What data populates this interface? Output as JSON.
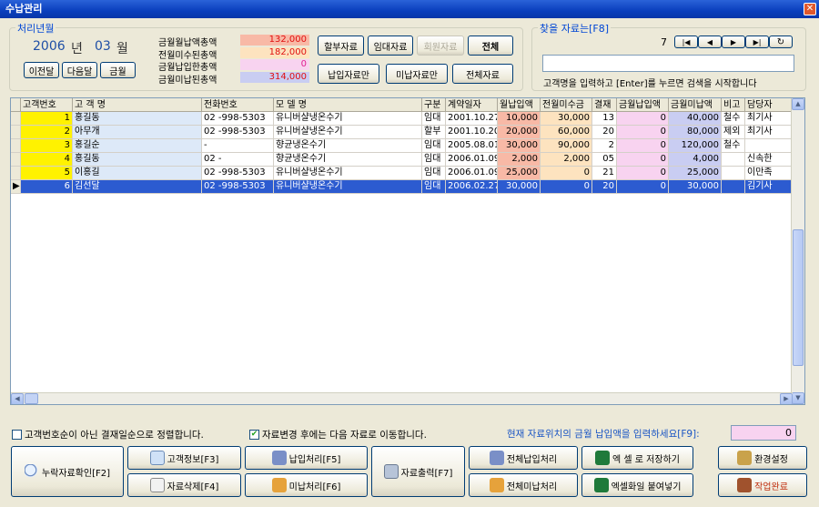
{
  "window": {
    "title": "수납관리"
  },
  "period": {
    "legend": "처리년월",
    "year": "2006",
    "year_unit": "년",
    "month": "03",
    "month_unit": "월",
    "prev_label": "이전달",
    "next_label": "다음달",
    "current_label": "금월"
  },
  "summary": [
    {
      "label": "금월월납액총액",
      "value": "132,000",
      "color": "#f8b9a6"
    },
    {
      "label": "전월미수된총액",
      "value": "182,000",
      "color": "#fde3bf"
    },
    {
      "label": "금월납입한총액",
      "value": "0",
      "color": "#f8d3f0"
    },
    {
      "label": "금월미납된총액",
      "value": "314,000",
      "color": "#c9cdf2"
    }
  ],
  "filters": {
    "installment": "할부자료",
    "rental": "임대자료",
    "member": "회원자료",
    "all": "전체",
    "paid_only": "납입자료만",
    "unpaid_only": "미납자료만",
    "all_data": "전체자료"
  },
  "search": {
    "legend": "찾을 자료는[F8]",
    "record_no": "7",
    "placeholder": "",
    "hint": "고객명을 입력하고 [Enter]를 누르면 검색을 시작합니다"
  },
  "table": {
    "headers": [
      "고객번호",
      "고 객 명",
      "전화번호",
      "모   델   명",
      "구분",
      "계약일자",
      "월납입액",
      "전월미수금",
      "결재",
      "금월납입액",
      "금월미납액",
      "비고",
      "담당자"
    ],
    "rows": [
      [
        "1",
        "홍길동",
        "02  -998-5303",
        "유니버샬냉온수기",
        "임대",
        "2001.10.27",
        "10,000",
        "30,000",
        "13",
        "0",
        "40,000",
        "철수",
        "최기사"
      ],
      [
        "2",
        "아무개",
        "02  -998-5303",
        "유니버샬냉온수기",
        "할부",
        "2001.10.20",
        "20,000",
        "60,000",
        "20",
        "0",
        "80,000",
        "제외",
        "최기사"
      ],
      [
        "3",
        "홍길순",
        "      -",
        "향균냉온수기",
        "임대",
        "2005.08.01",
        "30,000",
        "90,000",
        "2",
        "0",
        "120,000",
        "철수",
        ""
      ],
      [
        "4",
        "홍길동",
        "02  -",
        "향균냉온수기",
        "임대",
        "2006.01.09",
        "2,000",
        "2,000",
        "05",
        "0",
        "4,000",
        "",
        "신속한"
      ],
      [
        "5",
        "이홍길",
        "02  -998-5303",
        "유니버샬냉온수기",
        "임대",
        "2006.01.09",
        "25,000",
        "0",
        "21",
        "0",
        "25,000",
        "",
        "이만족"
      ],
      [
        "6",
        "김선달",
        "02  -998-5303",
        "유니버샬냉온수기",
        "임대",
        "2006.02.27",
        "30,000",
        "0",
        "20",
        "0",
        "30,000",
        "",
        "김기사"
      ]
    ],
    "selected_row": 5
  },
  "options": {
    "sort_label": "고객번호순이 아닌 결재일순으로 정렬합니다.",
    "sort_checked": false,
    "move_label": "자료변경 후에는 다음 자료로 이동합니다.",
    "move_checked": true,
    "input_prompt": "현재 자료위치의 금월 납입액을 입력하세요[F9]:",
    "input_value": "0"
  },
  "actions": {
    "missing": "누락자료확인[F2]",
    "customer_info": "고객정보[F3]",
    "delete": "자료삭제[F4]",
    "pay": "납입처리[F5]",
    "unpaid": "미납처리[F6]",
    "print": "자료출력[F7]",
    "all_pay": "전체납입처리",
    "all_unpaid": "전체미납처리",
    "excel_save": "엑 셀 로 저장하기",
    "excel_paste": "엑셀화일 붙여넣기",
    "settings": "환경설정",
    "done": "작업완료"
  }
}
